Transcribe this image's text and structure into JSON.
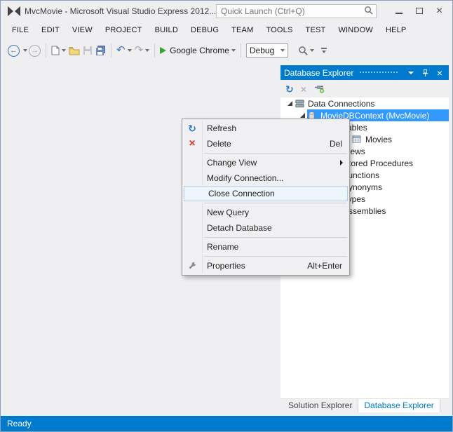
{
  "window": {
    "title": "MvcMovie - Microsoft Visual Studio Express 2012...",
    "quick_launch_placeholder": "Quick Launch (Ctrl+Q)"
  },
  "menu_bar": {
    "items": [
      "FILE",
      "EDIT",
      "VIEW",
      "PROJECT",
      "BUILD",
      "DEBUG",
      "TEAM",
      "TOOLS",
      "TEST",
      "WINDOW",
      "HELP"
    ]
  },
  "toolbar": {
    "run_target": "Google Chrome",
    "configuration": "Debug"
  },
  "database_explorer": {
    "title": "Database Explorer",
    "tree": [
      {
        "label": "Data Connections",
        "level": 0,
        "expanded": true,
        "icon": "server-icon"
      },
      {
        "label": "MovieDBContext (MvcMovie)",
        "level": 1,
        "expanded": true,
        "selected": true,
        "icon": "database-icon"
      },
      {
        "label": "Tables",
        "level": 2,
        "expanded": true,
        "icon": "folder-icon"
      },
      {
        "label": "Movies",
        "level": 3,
        "icon": "table-icon"
      },
      {
        "label": "Views",
        "level": 2,
        "expanded": false,
        "icon": "folder-icon"
      },
      {
        "label": "Stored Procedures",
        "level": 2,
        "expanded": false,
        "icon": "folder-icon"
      },
      {
        "label": "Functions",
        "level": 2,
        "expanded": false,
        "icon": "folder-icon"
      },
      {
        "label": "Synonyms",
        "level": 2,
        "expanded": false,
        "icon": "folder-icon"
      },
      {
        "label": "Types",
        "level": 2,
        "expanded": false,
        "icon": "folder-icon"
      },
      {
        "label": "Assemblies",
        "level": 2,
        "expanded": false,
        "icon": "folder-icon"
      }
    ],
    "tabs": [
      {
        "label": "Solution Explorer",
        "active": false
      },
      {
        "label": "Database Explorer",
        "active": true
      }
    ]
  },
  "context_menu": {
    "items": [
      {
        "label": "Refresh",
        "icon": "refresh-icon"
      },
      {
        "label": "Delete",
        "icon": "delete-icon",
        "shortcut": "Del"
      },
      {
        "type": "separator"
      },
      {
        "label": "Change View",
        "submenu": true
      },
      {
        "label": "Modify Connection..."
      },
      {
        "label": "Close Connection",
        "highlighted": true
      },
      {
        "type": "separator"
      },
      {
        "label": "New Query"
      },
      {
        "label": "Detach Database"
      },
      {
        "type": "separator"
      },
      {
        "label": "Rename"
      },
      {
        "type": "separator"
      },
      {
        "label": "Properties",
        "icon": "wrench-icon",
        "shortcut": "Alt+Enter"
      }
    ]
  },
  "status_bar": {
    "text": "Ready"
  },
  "colors": {
    "accent": "#007ACC",
    "selection_blue": "#3399FF",
    "status_bar": "#007ACC",
    "play_green": "#37A437",
    "delete_red": "#D23E2F",
    "chrome_gray": "#EFEFF2"
  }
}
